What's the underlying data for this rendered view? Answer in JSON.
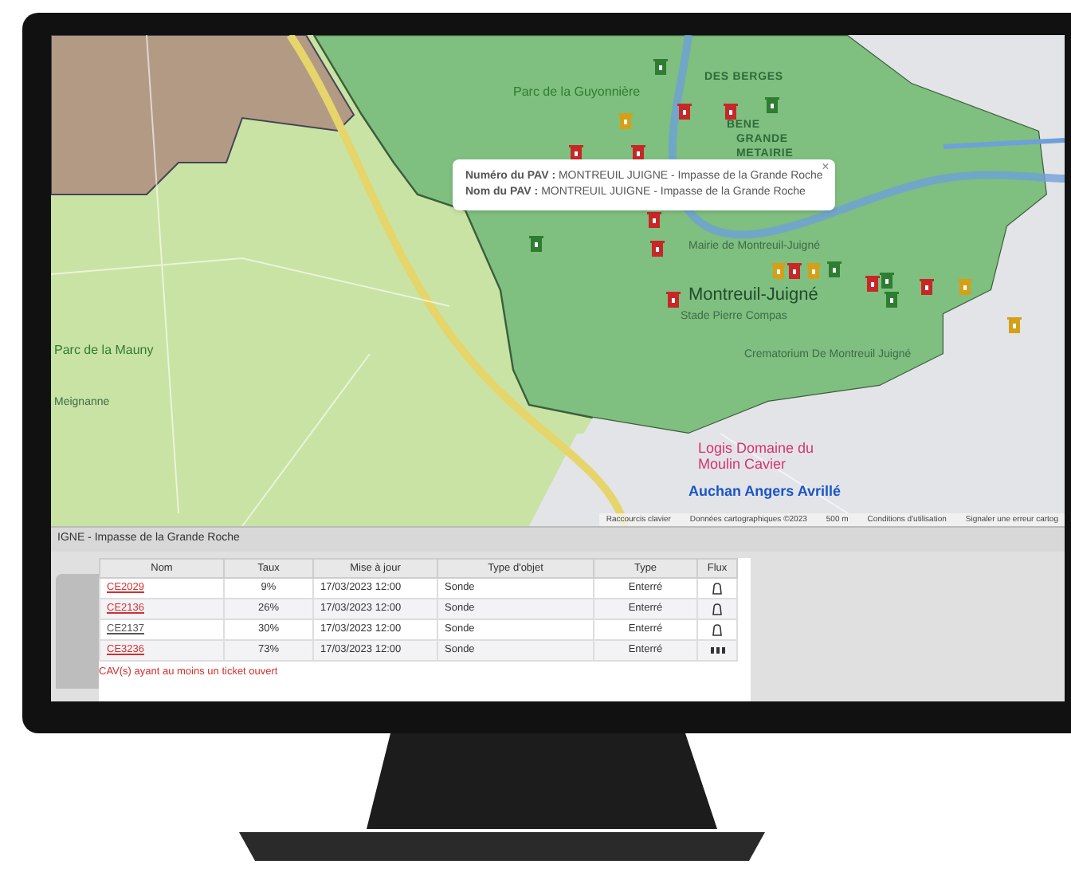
{
  "map": {
    "labels": [
      {
        "text": "Parc de la Guyonnière",
        "kind": "park"
      },
      {
        "text": "DES BERGES",
        "kind": "area"
      },
      {
        "text": "BENE",
        "kind": "area"
      },
      {
        "text": "GRANDE",
        "kind": "area"
      },
      {
        "text": "METAIRIE",
        "kind": "area"
      },
      {
        "text": "Mairie de Montreuil-Juigné",
        "kind": "place"
      },
      {
        "text": "Montreuil-Juigné",
        "kind": "town"
      },
      {
        "text": "Stade Pierre Compas",
        "kind": "place"
      },
      {
        "text": "Crematorium De Montreuil Juigné",
        "kind": "place"
      },
      {
        "text": "Logis Domaine du Moulin Cavier",
        "kind": "poi"
      },
      {
        "text": "Auchan Angers Avrillé",
        "kind": "shop"
      },
      {
        "text": "Parc de la Mauny",
        "kind": "park"
      },
      {
        "text": "Meignanne",
        "kind": "place"
      }
    ],
    "markers": [
      {
        "color": "#2e7d32"
      },
      {
        "color": "#c62828"
      },
      {
        "color": "#c62828"
      },
      {
        "color": "#2e7d32"
      },
      {
        "color": "#c62828"
      },
      {
        "color": "#d4a017"
      },
      {
        "color": "#c62828"
      },
      {
        "color": "#2e7d32"
      },
      {
        "color": "#c62828"
      },
      {
        "color": "#c62828"
      },
      {
        "color": "#c62828"
      },
      {
        "color": "#d4a017"
      },
      {
        "color": "#c62828"
      },
      {
        "color": "#d4a017"
      },
      {
        "color": "#2e7d32"
      },
      {
        "color": "#c62828"
      },
      {
        "color": "#2e7d32"
      },
      {
        "color": "#2e7d32"
      },
      {
        "color": "#c62828"
      },
      {
        "color": "#d4a017"
      },
      {
        "color": "#d4a017"
      }
    ],
    "popup": {
      "lines": [
        "**Numéro du PAV :** MONTREUIL JUIGNE - Impasse de la Grande Roche",
        "**Nom du PAV :** MONTREUIL JUIGNE - Impasse de la Grande Roche"
      ],
      "close": "×"
    },
    "attribution": [
      "Raccourcis clavier",
      "Données cartographiques ©2023",
      "500 m",
      "Conditions d'utilisation",
      "Signaler une erreur cartog"
    ]
  },
  "title_bar": "IGNE - Impasse de la Grande Roche",
  "table": {
    "columns": [
      "Nom",
      "Taux",
      "Mise à jour",
      "Type d'objet",
      "Type",
      "Flux"
    ],
    "rows": [
      {
        "name": "CE2029",
        "alert": true,
        "rate": "9%",
        "updated": "17/03/2023 12:00",
        "object_type": "Sonde",
        "type": "Enterré",
        "kind": "drop"
      },
      {
        "name": "CE2136",
        "alert": true,
        "rate": "26%",
        "updated": "17/03/2023 12:00",
        "object_type": "Sonde",
        "type": "Enterré",
        "kind": "drop"
      },
      {
        "name": "CE2137",
        "alert": false,
        "rate": "30%",
        "updated": "17/03/2023 12:00",
        "object_type": "Sonde",
        "type": "Enterré",
        "kind": "drop"
      },
      {
        "name": "CE3236",
        "alert": true,
        "rate": "73%",
        "updated": "17/03/2023 12:00",
        "object_type": "Sonde",
        "type": "Enterré",
        "kind": "bars"
      }
    ]
  },
  "footnote": "CAV(s) ayant au moins un ticket ouvert"
}
